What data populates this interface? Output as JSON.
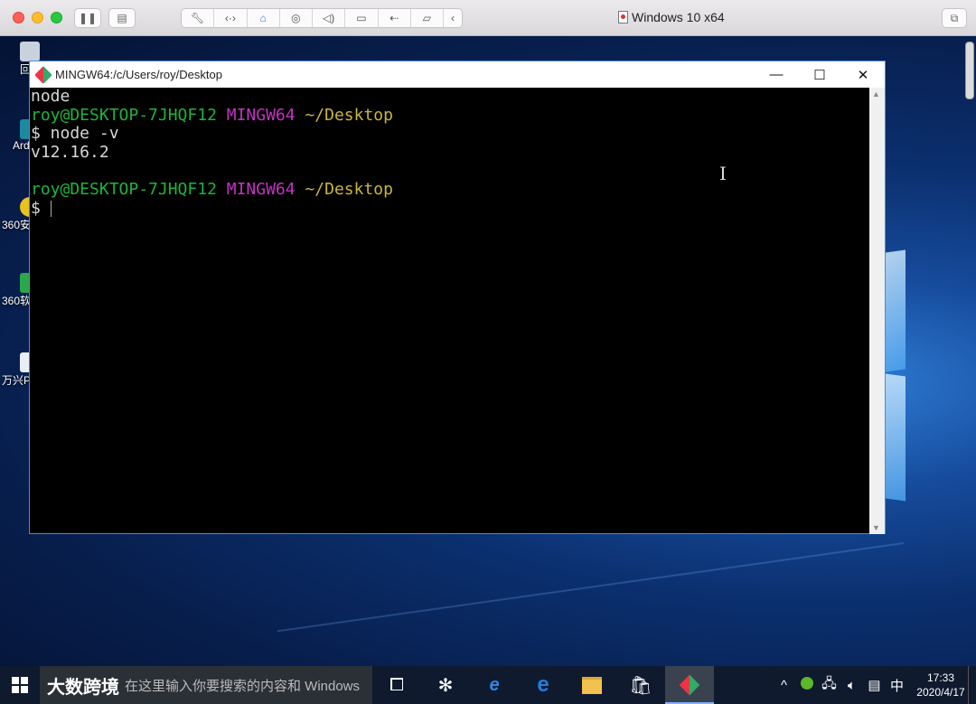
{
  "vm": {
    "window_title": "Windows 10 x64",
    "colors": {
      "close": "#fe5f57",
      "minimize": "#febc2e",
      "zoom": "#28c840"
    },
    "toolbar_icons": [
      "pause-icon",
      "snapshot-icon",
      "wrench-icon",
      "code-brackets-icon",
      "hard-disk-icon",
      "webcam-icon",
      "speaker-icon",
      "camera-icon",
      "usb-icon",
      "shared-folder-icon",
      "chevron-left-icon"
    ]
  },
  "desktop": {
    "icons": [
      {
        "label": "回",
        "icon": "recycle-bin-icon"
      },
      {
        "label": "Ard",
        "icon": "arduino-icon"
      },
      {
        "label": "360安",
        "icon": "360-security-icon"
      },
      {
        "label": "360软",
        "icon": "360-software-icon"
      },
      {
        "label": "万兴P",
        "icon": "wondershare-icon"
      }
    ]
  },
  "terminal": {
    "title": "MINGW64:/c/Users/roy/Desktop",
    "lines": {
      "l1": "node",
      "l2_user": "roy@DESKTOP-7JHQF12",
      "l2_env": "MINGW64",
      "l2_path": "~/Desktop",
      "l3": "$ node -v",
      "l4": "v12.16.2",
      "l6_user": "roy@DESKTOP-7JHQF12",
      "l6_env": "MINGW64",
      "l6_path": "~/Desktop",
      "l7": "$ "
    },
    "colors": {
      "user": "#1cb53a",
      "env": "#c531c4",
      "path": "#c9b63a",
      "text": "#d8d8d8",
      "background": "#000000"
    },
    "controls": {
      "minimize": "—",
      "maximize": "☐",
      "close": "✕"
    }
  },
  "taskbar": {
    "search_text": "在这里输入你要搜索的内容和 Windows",
    "watermark": "大数跨境",
    "apps": [
      "task-view-icon",
      "pinwheel-app-icon",
      "internet-explorer-icon",
      "edge-icon",
      "file-explorer-icon",
      "store-icon",
      "git-icon"
    ],
    "tray": {
      "chevron": "^",
      "ime": "中",
      "time": "17:33",
      "date": "2020/4/17"
    }
  }
}
